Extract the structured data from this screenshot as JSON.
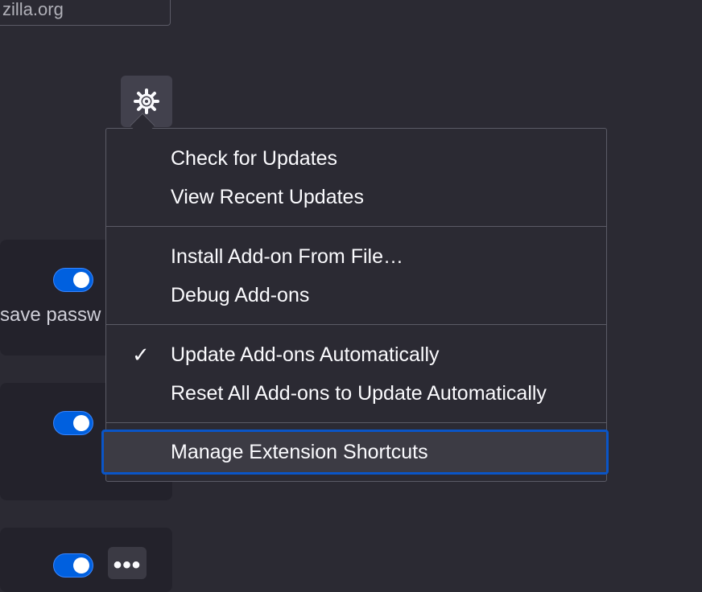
{
  "background": {
    "url_fragment": "zilla.org",
    "card_text_fragment": "save passw"
  },
  "gear_button": {
    "icon": "gear-icon"
  },
  "menu": {
    "items": [
      {
        "label": "Check for Updates",
        "checked": false
      },
      {
        "label": "View Recent Updates",
        "checked": false
      },
      {
        "label": "Install Add-on From File…",
        "checked": false
      },
      {
        "label": "Debug Add-ons",
        "checked": false
      },
      {
        "label": "Update Add-ons Automatically",
        "checked": true
      },
      {
        "label": "Reset All Add-ons to Update Automatically",
        "checked": false
      },
      {
        "label": "Manage Extension Shortcuts",
        "checked": false,
        "focused": true
      }
    ],
    "check_glyph": "✓"
  },
  "colors": {
    "background": "#2b2a33",
    "accent": "#0060df",
    "focus_ring": "#0a55c7"
  }
}
